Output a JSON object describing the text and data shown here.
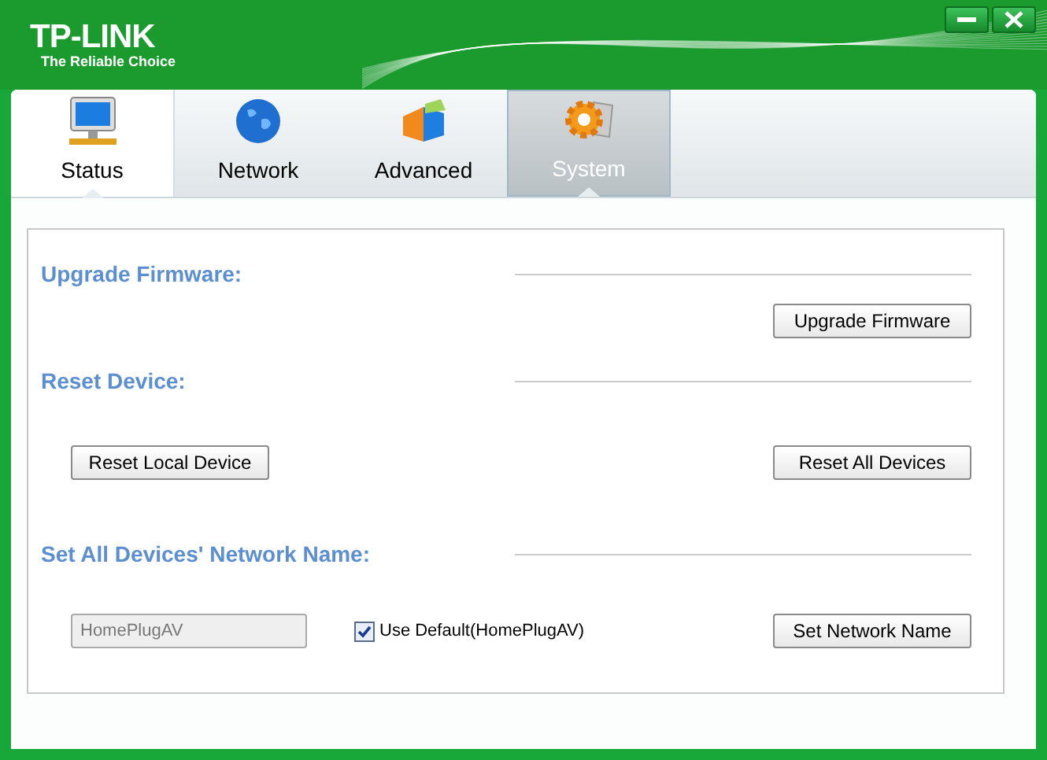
{
  "logo": {
    "name": "TP-LINK",
    "tagline": "The Reliable Choice"
  },
  "tabs": [
    {
      "label": "Status",
      "selected": false,
      "highlighted": true
    },
    {
      "label": "Network",
      "selected": false,
      "highlighted": false
    },
    {
      "label": "Advanced",
      "selected": false,
      "highlighted": false
    },
    {
      "label": "System",
      "selected": true,
      "highlighted": false
    }
  ],
  "sections": [
    {
      "title": "Upgrade Firmware:",
      "controls": [
        {
          "kind": "button",
          "label": "Upgrade Firmware"
        }
      ]
    },
    {
      "title": "Reset Device:",
      "controls": [
        {
          "kind": "button",
          "label": "Reset Local Device"
        },
        {
          "kind": "button",
          "label": "Reset All Devices"
        }
      ]
    },
    {
      "title": "Set All Devices' Network Name:",
      "controls": [
        {
          "kind": "field",
          "value": "HomePlugAV",
          "disabled": true
        },
        {
          "kind": "checkbox",
          "label": "Use Default(HomePlugAV)",
          "checked": true
        },
        {
          "kind": "button",
          "label": "Set Network Name"
        }
      ]
    }
  ]
}
